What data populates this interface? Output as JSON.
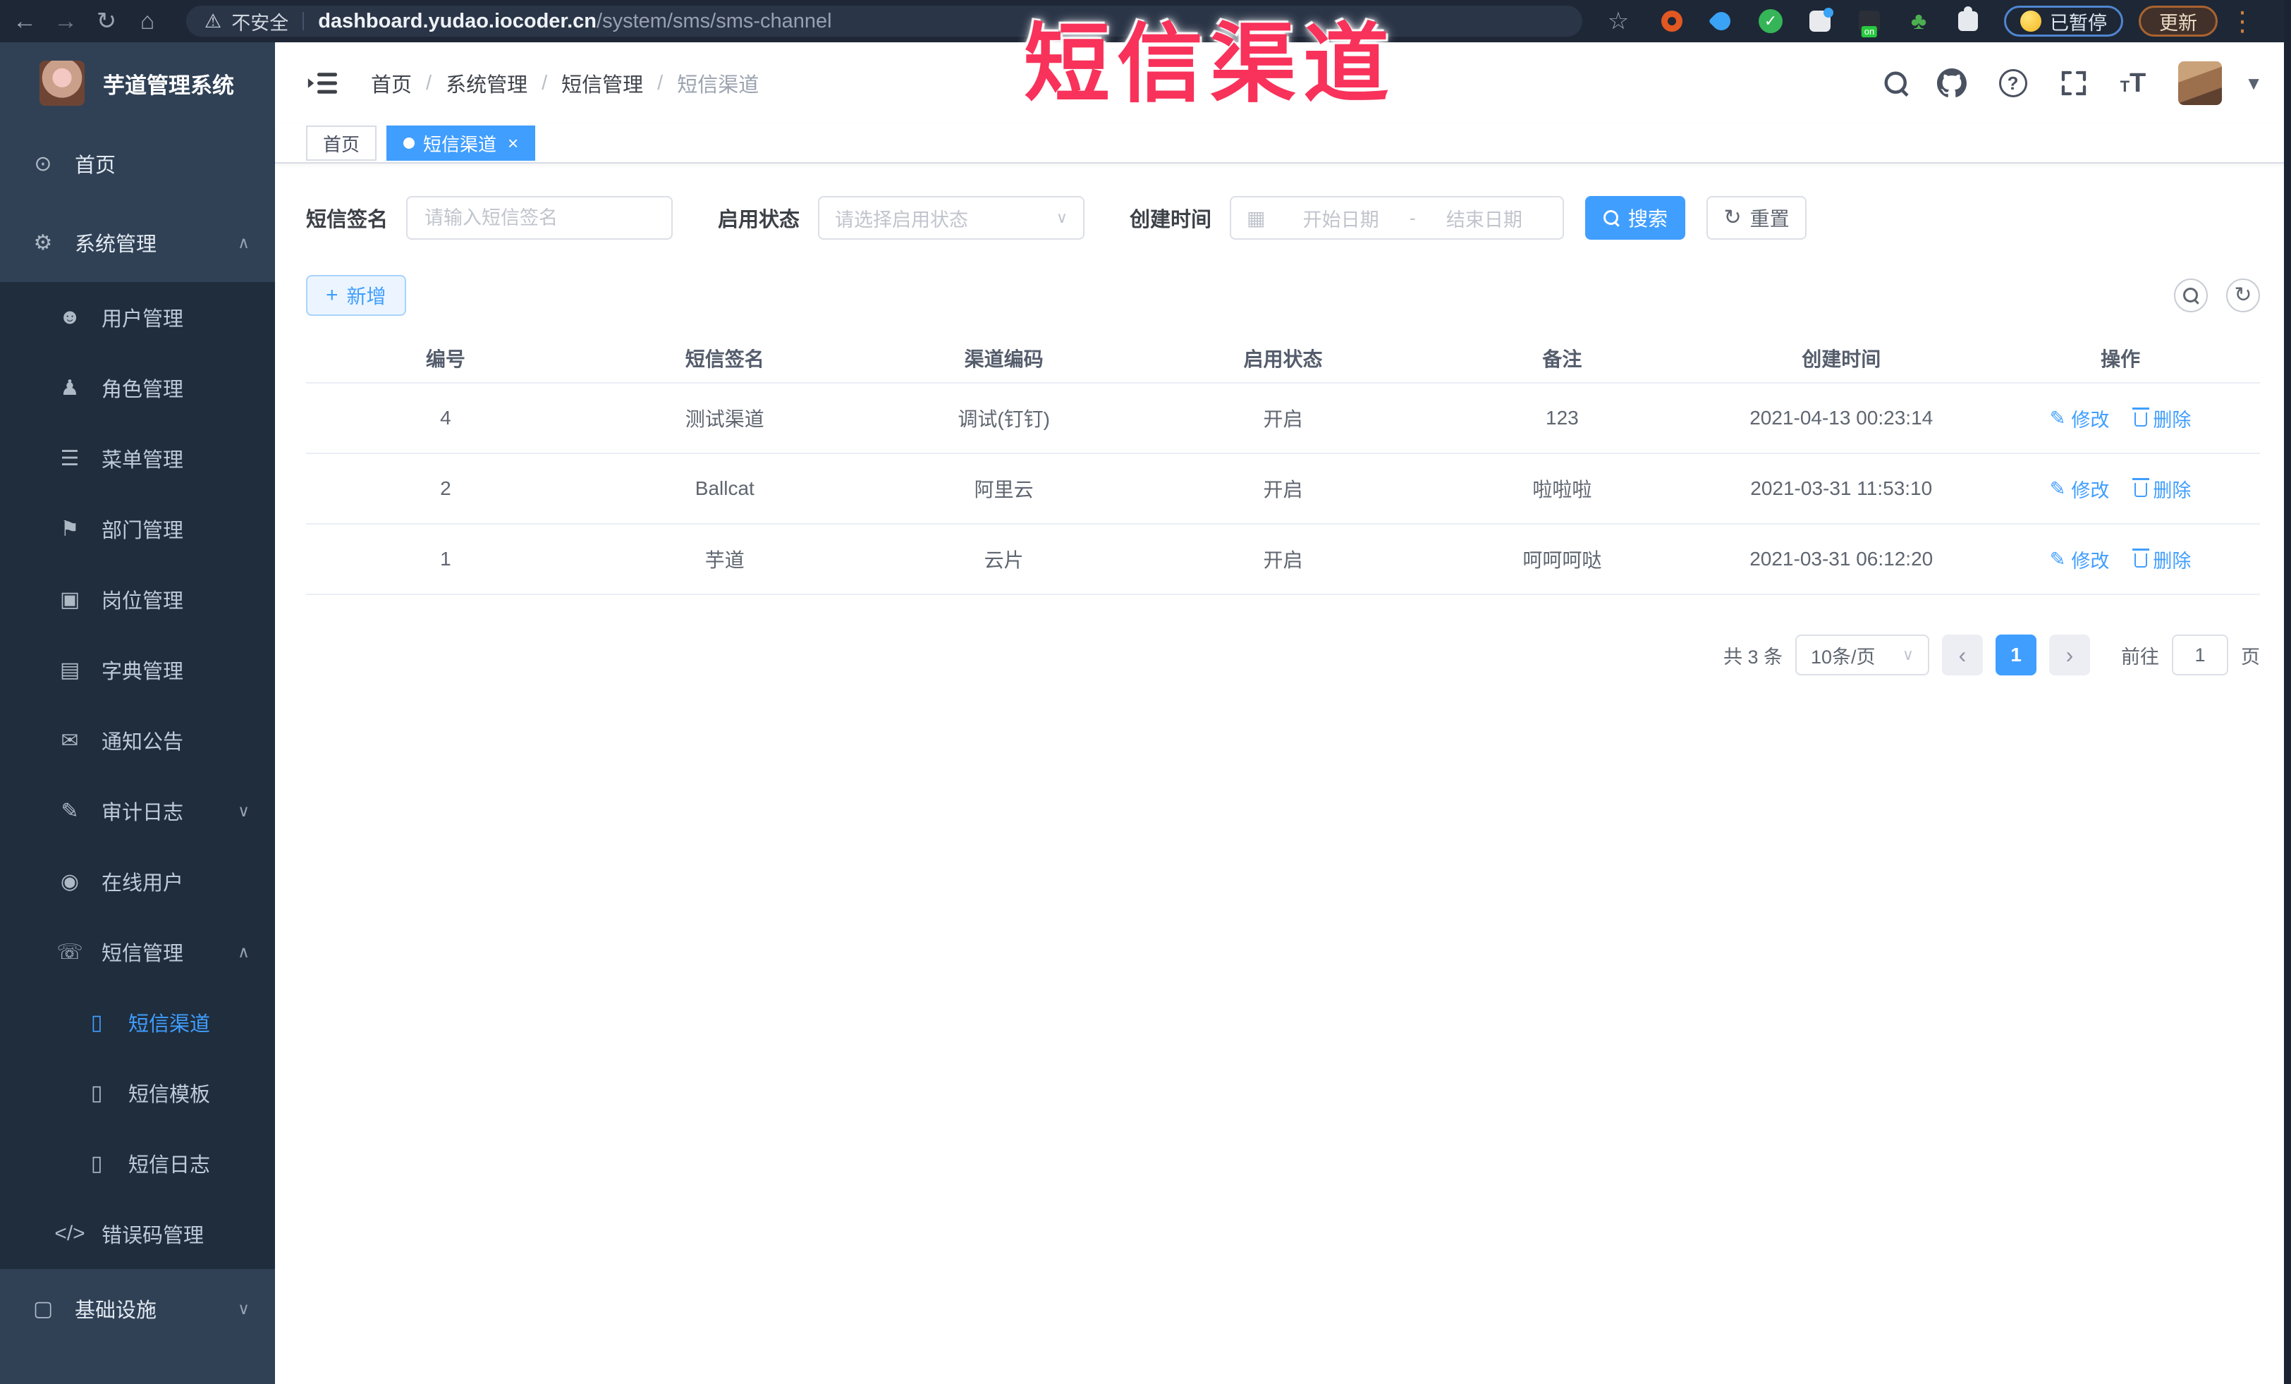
{
  "colors": {
    "accent": "#409eff",
    "overlay": "#f8325a",
    "sidebar_bg": "#304156",
    "submenu_bg": "#1f2d3d",
    "browser_bg": "#1e2736"
  },
  "overlay": {
    "title": "短信渠道"
  },
  "browser": {
    "security_label": "不安全",
    "url_host": "dashboard.yudao.iocoder.cn",
    "url_path": "/system/sms/sms-channel",
    "paused_badge": "已暂停",
    "update_button": "更新"
  },
  "sidebar": {
    "app_title": "芋道管理系统",
    "items": [
      {
        "name": "home",
        "label": "首页",
        "level": 1,
        "icon": "dashboard-icon"
      },
      {
        "name": "system-mgmt",
        "label": "系统管理",
        "level": 1,
        "icon": "gear-icon",
        "arrow": "up"
      },
      {
        "name": "user-mgmt",
        "label": "用户管理",
        "level": 2,
        "icon": "user-icon"
      },
      {
        "name": "role-mgmt",
        "label": "角色管理",
        "level": 2,
        "icon": "role-icon"
      },
      {
        "name": "menu-mgmt",
        "label": "菜单管理",
        "level": 2,
        "icon": "menu-list-icon"
      },
      {
        "name": "dept-mgmt",
        "label": "部门管理",
        "level": 2,
        "icon": "org-tree-icon"
      },
      {
        "name": "post-mgmt",
        "label": "岗位管理",
        "level": 2,
        "icon": "post-icon"
      },
      {
        "name": "dict-mgmt",
        "label": "字典管理",
        "level": 2,
        "icon": "dict-icon"
      },
      {
        "name": "notice",
        "label": "通知公告",
        "level": 2,
        "icon": "notice-icon"
      },
      {
        "name": "audit-log",
        "label": "审计日志",
        "level": 2,
        "icon": "audit-log-icon",
        "arrow": "down"
      },
      {
        "name": "online-user",
        "label": "在线用户",
        "level": 2,
        "icon": "online-user-icon"
      },
      {
        "name": "sms-mgmt",
        "label": "短信管理",
        "level": 2,
        "icon": "sms-icon",
        "arrow": "up"
      },
      {
        "name": "sms-channel",
        "label": "短信渠道",
        "level": 3,
        "icon": "sms-channel-icon",
        "active": true
      },
      {
        "name": "sms-template",
        "label": "短信模板",
        "level": 3,
        "icon": "sms-template-icon"
      },
      {
        "name": "sms-log",
        "label": "短信日志",
        "level": 3,
        "icon": "sms-log-icon"
      },
      {
        "name": "error-code-mgmt",
        "label": "错误码管理",
        "level": 2,
        "icon": "error-code-icon"
      },
      {
        "name": "infrastructure",
        "label": "基础设施",
        "level": 1,
        "icon": "infra-icon",
        "arrow": "down"
      }
    ]
  },
  "breadcrumb": {
    "items": [
      "首页",
      "系统管理",
      "短信管理",
      "短信渠道"
    ]
  },
  "tabs": [
    {
      "name": "home",
      "label": "首页",
      "active": false
    },
    {
      "name": "sms-channel",
      "label": "短信渠道",
      "active": true,
      "closable": true
    }
  ],
  "filters": {
    "sign_label": "短信签名",
    "sign_placeholder": "请输入短信签名",
    "status_label": "启用状态",
    "status_placeholder": "请选择启用状态",
    "date_label": "创建时间",
    "date_start_placeholder": "开始日期",
    "date_separator": "-",
    "date_end_placeholder": "结束日期",
    "search_button": "搜索",
    "reset_button": "重置",
    "add_button": "新增"
  },
  "table": {
    "columns": [
      "编号",
      "短信签名",
      "渠道编码",
      "启用状态",
      "备注",
      "创建时间",
      "操作"
    ],
    "rows": [
      {
        "id": "4",
        "sign": "测试渠道",
        "code": "调试(钉钉)",
        "status": "开启",
        "remark": "123",
        "created": "2021-04-13 00:23:14"
      },
      {
        "id": "2",
        "sign": "Ballcat",
        "code": "阿里云",
        "status": "开启",
        "remark": "啦啦啦",
        "created": "2021-03-31 11:53:10"
      },
      {
        "id": "1",
        "sign": "芋道",
        "code": "云片",
        "status": "开启",
        "remark": "呵呵呵哒",
        "created": "2021-03-31 06:12:20"
      }
    ],
    "edit_label": "修改",
    "delete_label": "删除"
  },
  "pagination": {
    "total": "共 3 条",
    "page_size": "10条/页",
    "current_page": "1",
    "goto_label": "前往",
    "goto_value": "1",
    "page_unit": "页"
  }
}
